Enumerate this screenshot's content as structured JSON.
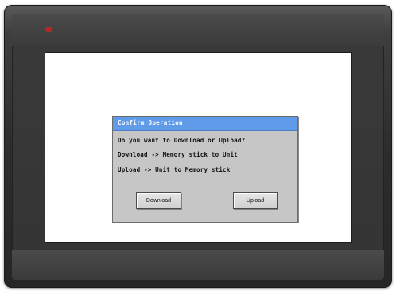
{
  "device": {
    "power_led_color": "#c81e1e",
    "bezel_color": "#2d2d2d"
  },
  "dialog": {
    "title": "Confirm Operation",
    "title_bar_color": "#5f9be8",
    "messages": [
      "Do you want to Download or Upload?",
      "Download -> Memory stick to Unit",
      "Upload -> Unit to Memory stick"
    ],
    "buttons": {
      "download_label": "Download",
      "upload_label": "Upload"
    }
  }
}
